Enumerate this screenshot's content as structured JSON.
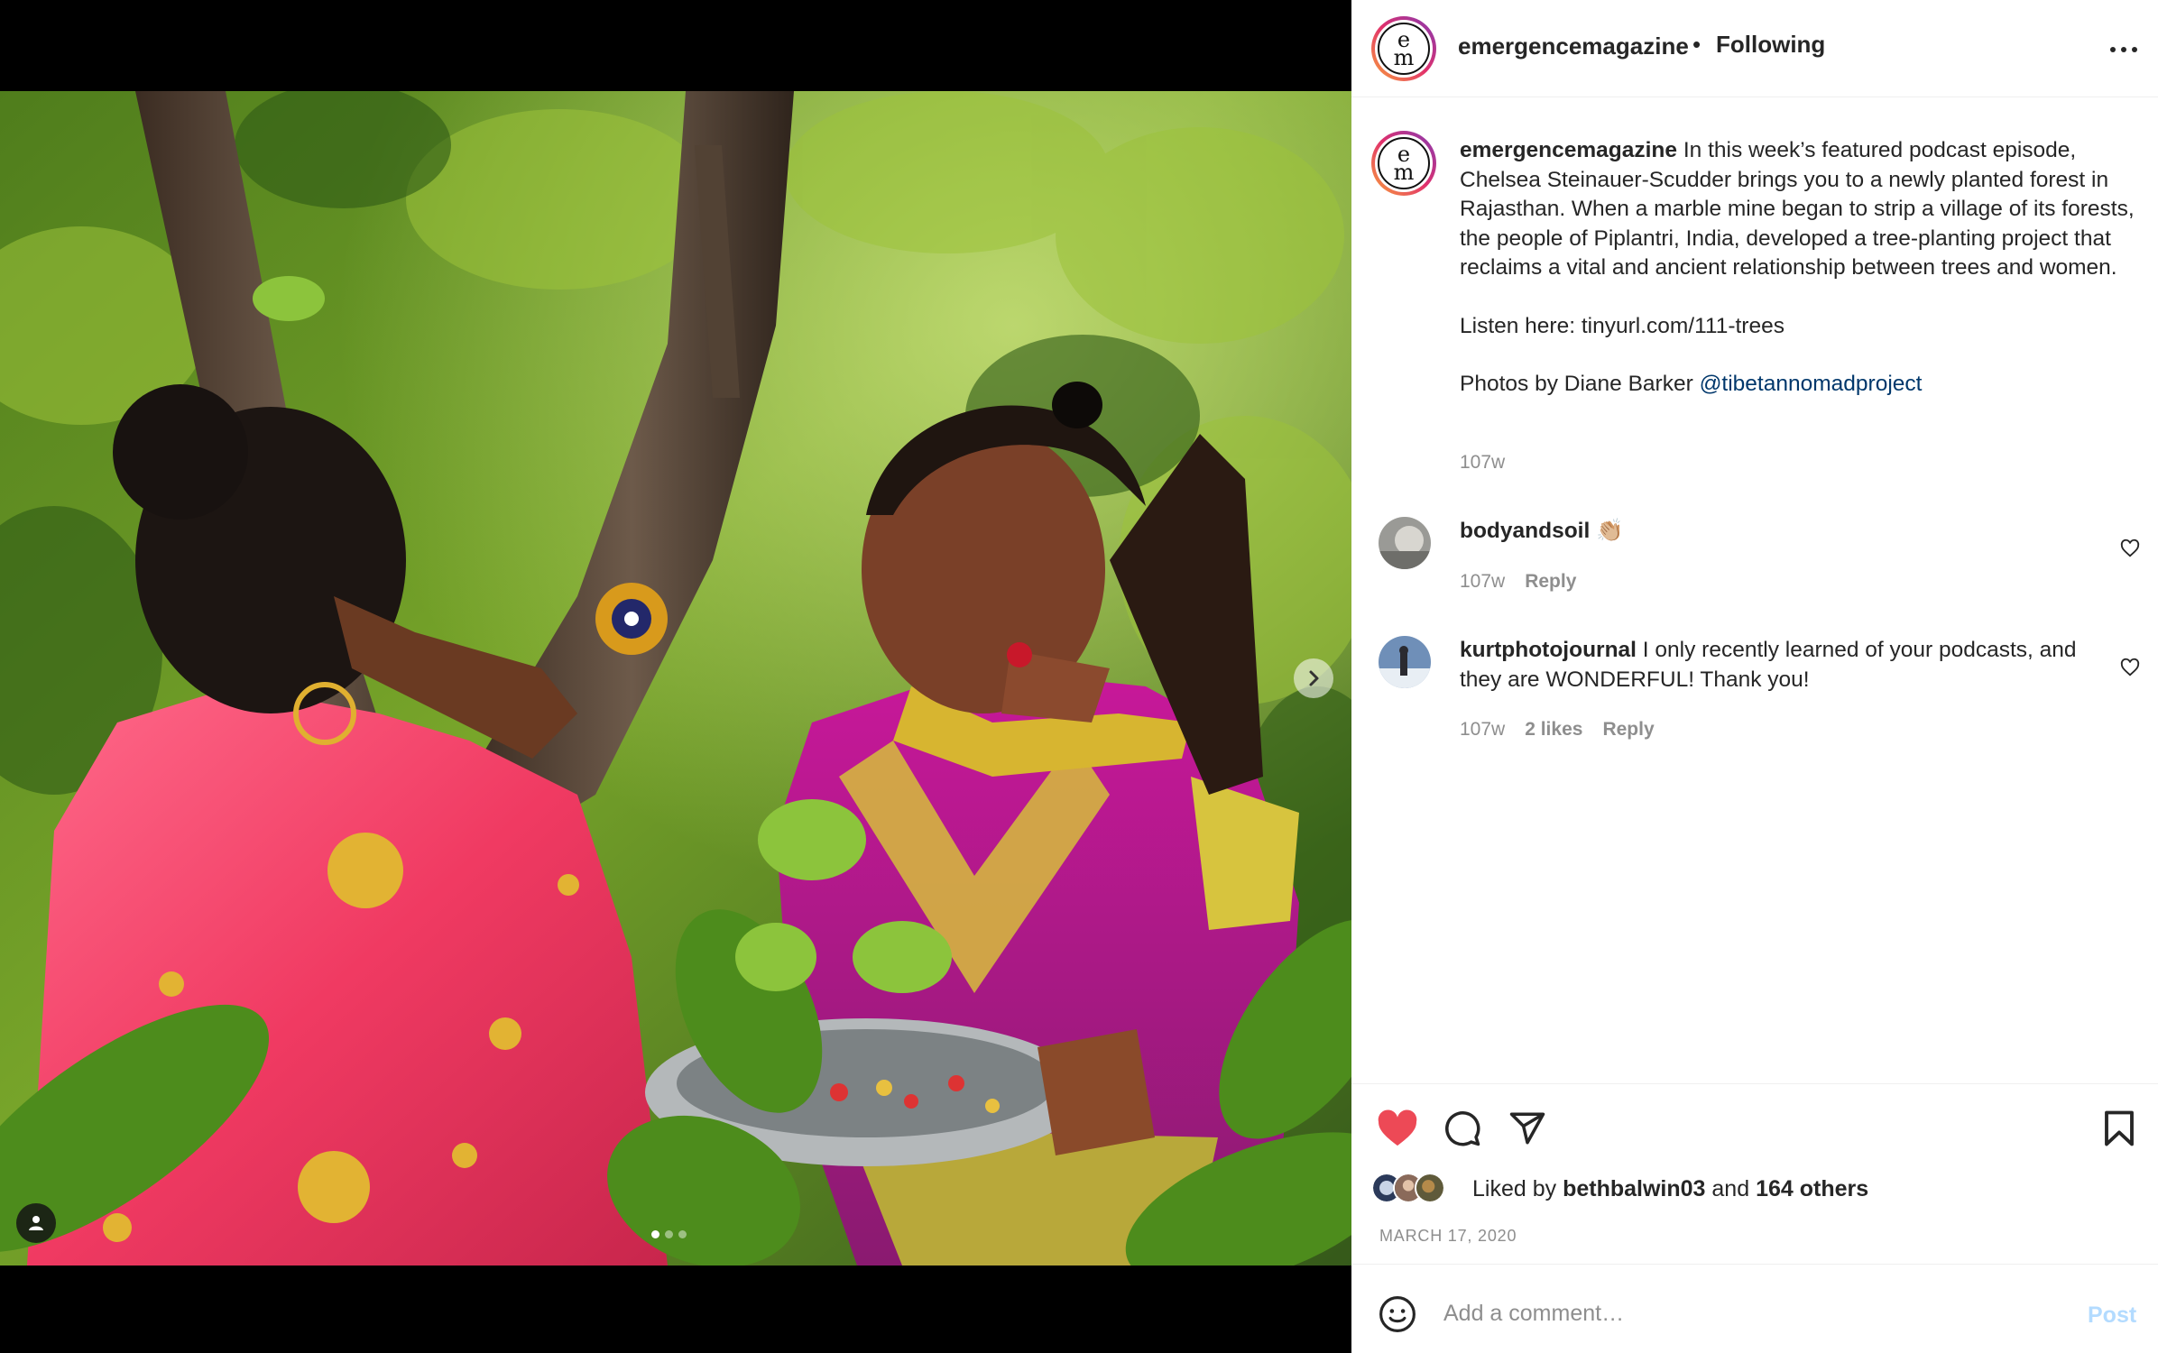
{
  "post": {
    "username": "emergencemagazine",
    "separator": "•",
    "follow_status": "Following",
    "avatar_letters": [
      "e",
      "m"
    ],
    "carousel": {
      "current_slide": 1,
      "total_slides": 3
    }
  },
  "caption": {
    "username": "emergencemagazine",
    "text": "In this week’s featured podcast episode, Chelsea Steinauer-Scudder brings you to a newly planted forest in Rajasthan. When a marble mine began to strip a village of its forests, the people of Piplantri, India, developed a tree-planting project that reclaims a vital and ancient relationship between trees and women.",
    "listen": "Listen here: tinyurl.com/111-trees",
    "photos_prefix": "Photos by Diane Barker ",
    "photos_mention": "@tibetannomadproject",
    "time": "107w"
  },
  "comments": [
    {
      "username": "bodyandsoil",
      "text": "👏🏼",
      "time": "107w",
      "likes": "",
      "reply": "Reply"
    },
    {
      "username": "kurtphotojournal",
      "text": "I only recently learned of your podcasts, and they are WONDERFUL! Thank you!",
      "time": "107w",
      "likes": "2 likes",
      "reply": "Reply"
    }
  ],
  "likes": {
    "prefix": "Liked by",
    "user": "bethbalwin03",
    "and": "and",
    "others": "164 others"
  },
  "date": "MARCH 17, 2020",
  "composer": {
    "placeholder": "Add a comment…",
    "post_label": "Post"
  },
  "colors": {
    "heart": "#ed4956",
    "mention": "#00376b",
    "post_disabled": "#b3dbff",
    "muted": "#8e8e8e"
  },
  "icons": [
    "chevron-right-icon",
    "user-tag-icon",
    "more-icon",
    "heart-icon",
    "comment-icon",
    "share-icon",
    "bookmark-icon",
    "emoji-icon"
  ]
}
